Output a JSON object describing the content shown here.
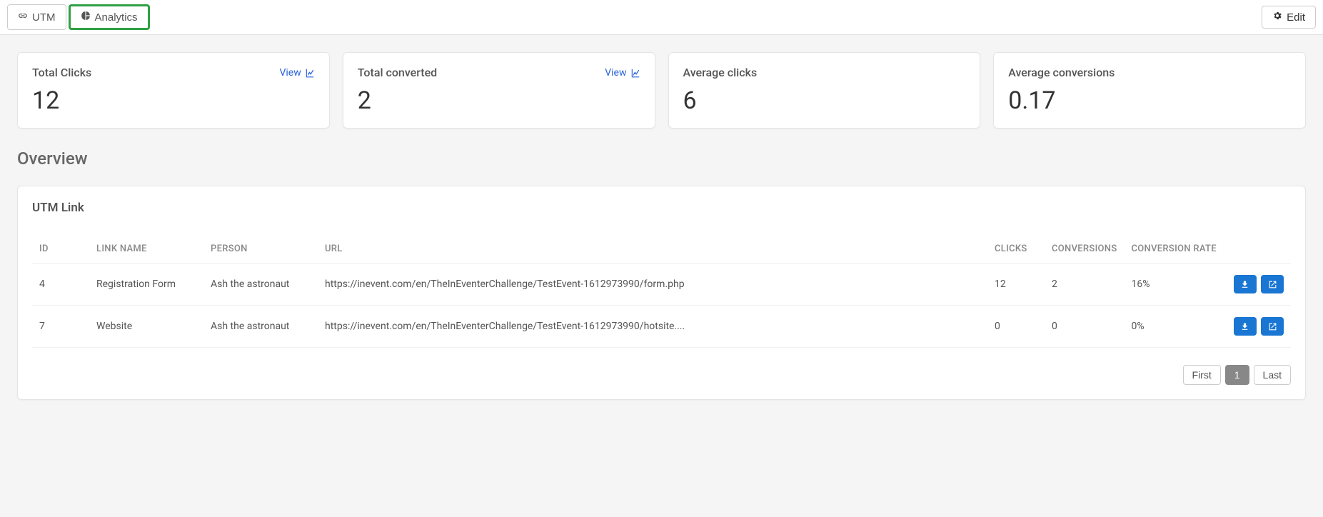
{
  "tabs": {
    "utm": "UTM",
    "analytics": "Analytics"
  },
  "edit_button": "Edit",
  "stats": [
    {
      "title": "Total Clicks",
      "value": "12",
      "view": "View"
    },
    {
      "title": "Total converted",
      "value": "2",
      "view": "View"
    },
    {
      "title": "Average clicks",
      "value": "6",
      "view": null
    },
    {
      "title": "Average conversions",
      "value": "0.17",
      "view": null
    }
  ],
  "overview_title": "Overview",
  "panel_title": "UTM Link",
  "table": {
    "headers": {
      "id": "ID",
      "link_name": "LINK NAME",
      "person": "PERSON",
      "url": "URL",
      "clicks": "CLICKS",
      "conversions": "CONVERSIONS",
      "conversion_rate": "CONVERSION RATE"
    },
    "rows": [
      {
        "id": "4",
        "link_name": "Registration Form",
        "person": "Ash the astronaut",
        "url": "https://inevent.com/en/TheInEventerChallenge/TestEvent-1612973990/form.php",
        "clicks": "12",
        "conversions": "2",
        "conversion_rate": "16%"
      },
      {
        "id": "7",
        "link_name": "Website",
        "person": "Ash the astronaut",
        "url": "https://inevent.com/en/TheInEventerChallenge/TestEvent-1612973990/hotsite....",
        "clicks": "0",
        "conversions": "0",
        "conversion_rate": "0%"
      }
    ]
  },
  "pagination": {
    "first": "First",
    "page": "1",
    "last": "Last"
  }
}
